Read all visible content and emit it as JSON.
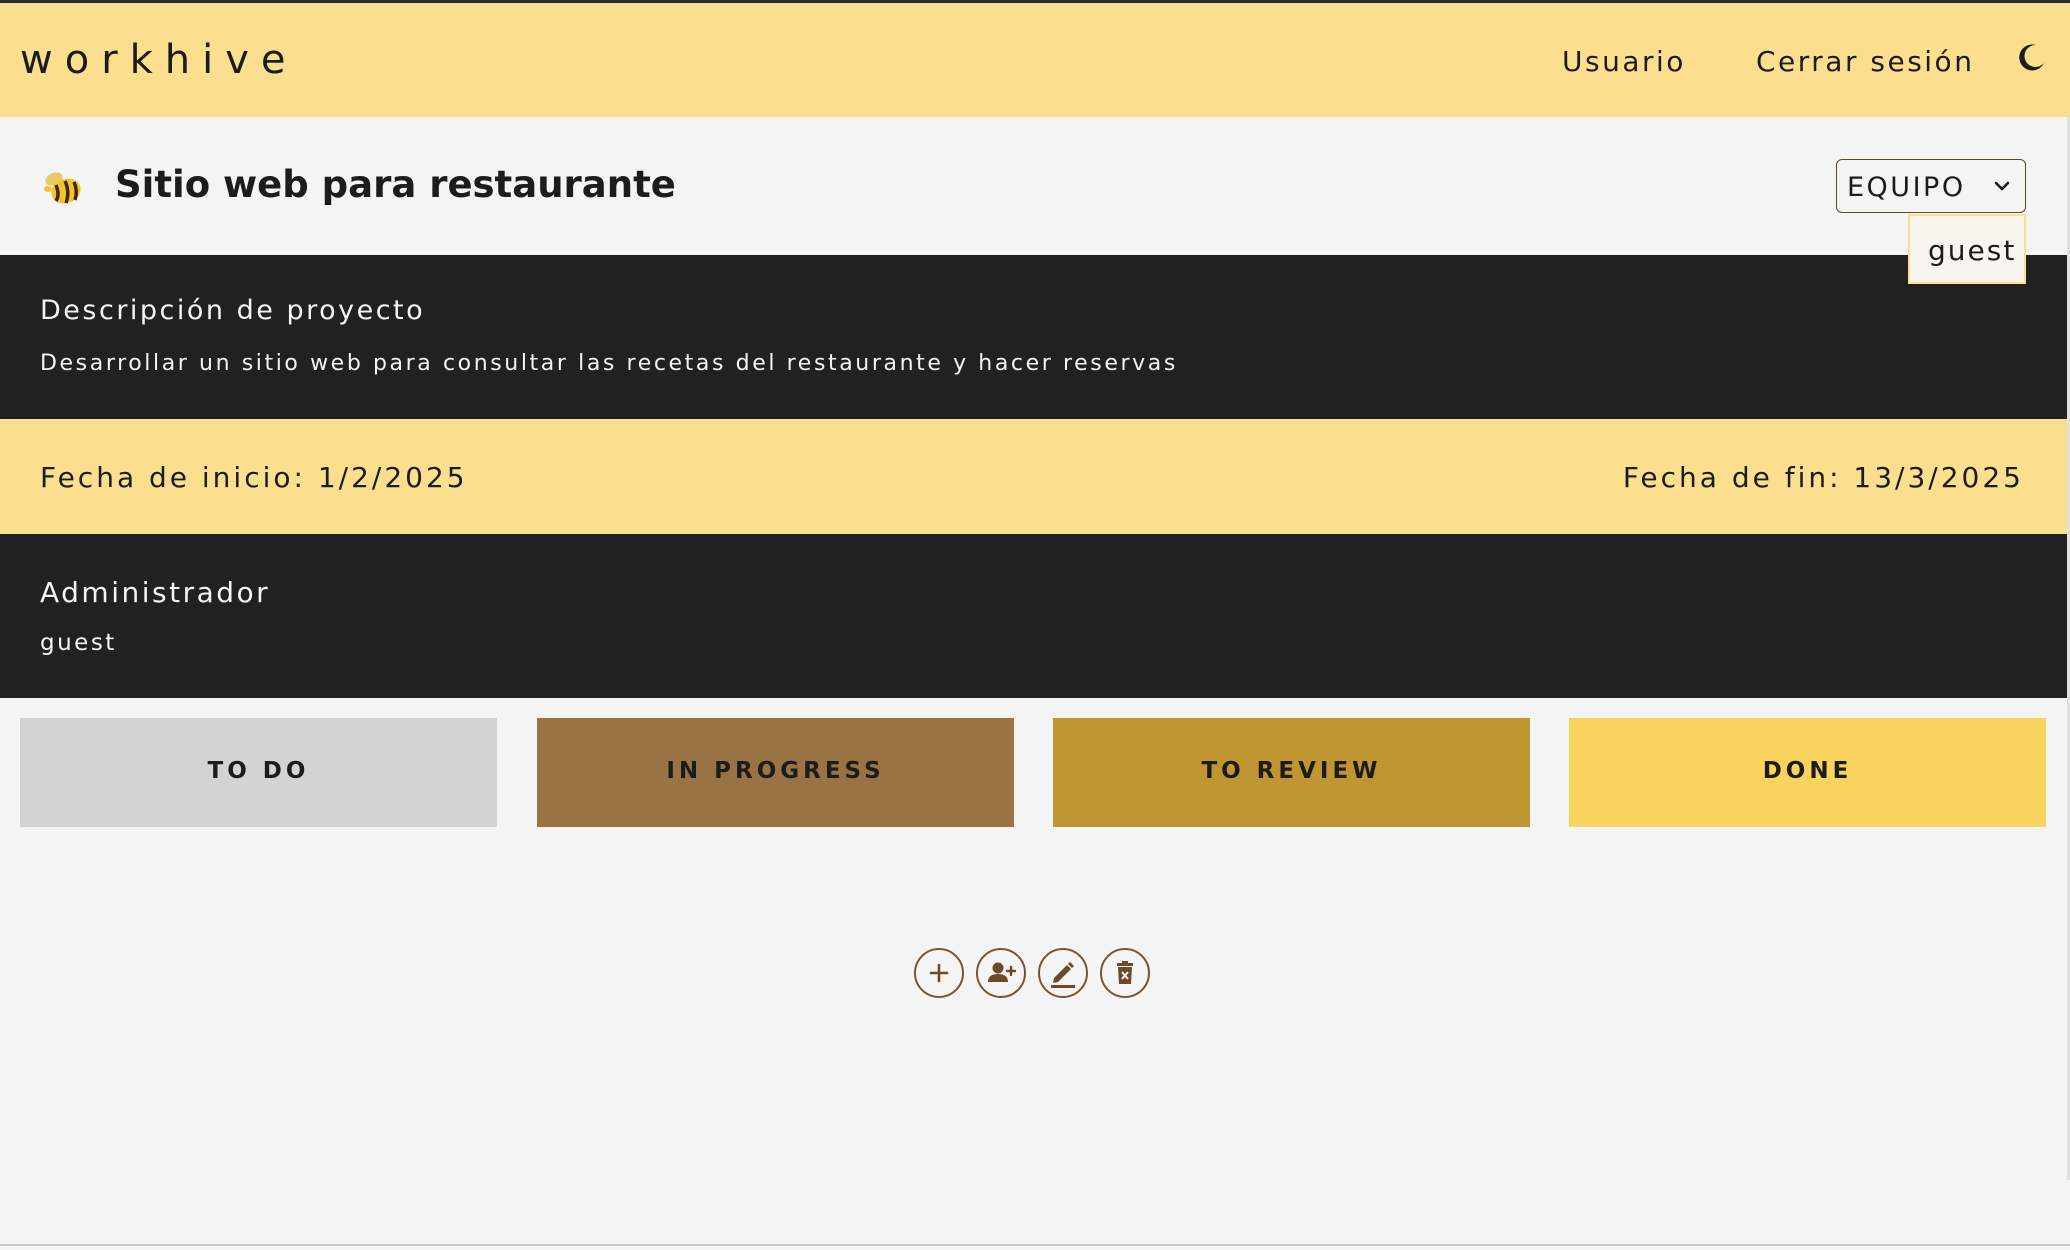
{
  "navbar": {
    "brand": "workhive",
    "user_link": "Usuario",
    "logout_link": "Cerrar sesión",
    "theme_icon": "moon-icon"
  },
  "project": {
    "title": "Sitio web para restaurante",
    "logo_icon": "bee-icon",
    "team_select": {
      "label": "EQUIPO",
      "options": [
        "guest"
      ]
    },
    "description_title": "Descripción de proyecto",
    "description": "Desarrollar un sitio web para consultar las recetas del restaurante y hacer reservas",
    "start_date": "Fecha de inicio: 1/2/2025",
    "end_date": "Fecha de fin: 13/3/2025",
    "admin_title": "Administrador",
    "admin_name": "guest"
  },
  "board": {
    "columns": [
      {
        "label": "TO DO",
        "color": "#d3d3d3"
      },
      {
        "label": "IN PROGRESS",
        "color": "#9a7345"
      },
      {
        "label": "TO REVIEW",
        "color": "#bf9632"
      },
      {
        "label": "DONE",
        "color": "#f8d45f"
      }
    ]
  },
  "actions": [
    {
      "icon": "plus-icon"
    },
    {
      "icon": "add-user-icon"
    },
    {
      "icon": "pencil-icon"
    },
    {
      "icon": "trash-icon"
    }
  ],
  "colors": {
    "accent_yellow": "#fbdf8e",
    "dark": "#212121",
    "brown": "#7a5530"
  }
}
